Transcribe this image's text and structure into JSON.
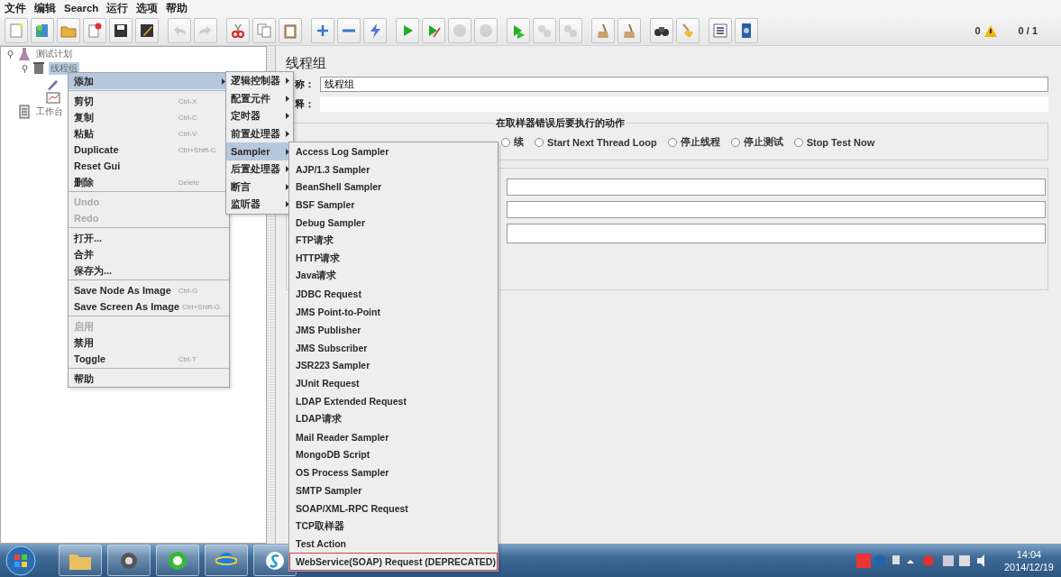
{
  "menubar": [
    "文件",
    "编辑",
    "Search",
    "运行",
    "选项",
    "帮助"
  ],
  "toolbar": {
    "groups": [
      [
        {
          "kind": "new",
          "disabled": false
        },
        {
          "kind": "templates",
          "disabled": false
        },
        {
          "kind": "open",
          "disabled": false
        },
        {
          "kind": "close",
          "disabled": false
        },
        {
          "kind": "save",
          "disabled": false
        },
        {
          "kind": "save_as",
          "disabled": false
        }
      ],
      [
        {
          "kind": "undo",
          "disabled": true
        },
        {
          "kind": "redo",
          "disabled": true
        }
      ],
      [
        {
          "kind": "cut",
          "disabled": false
        },
        {
          "kind": "copy",
          "disabled": false
        },
        {
          "kind": "paste",
          "disabled": false
        }
      ],
      [
        {
          "kind": "expand",
          "disabled": false
        },
        {
          "kind": "collapse",
          "disabled": false
        },
        {
          "kind": "toggle",
          "disabled": false
        }
      ],
      [
        {
          "kind": "start",
          "disabled": false
        },
        {
          "kind": "start_no_pause",
          "disabled": false
        },
        {
          "kind": "stop",
          "disabled": true
        },
        {
          "kind": "shutdown",
          "disabled": true
        }
      ],
      [
        {
          "kind": "remote_start",
          "disabled": false
        },
        {
          "kind": "remote_stop",
          "disabled": true
        },
        {
          "kind": "remote_shutdown",
          "disabled": true
        }
      ],
      [
        {
          "kind": "clear",
          "disabled": false
        },
        {
          "kind": "clear_all",
          "disabled": false
        }
      ],
      [
        {
          "kind": "search",
          "disabled": false
        },
        {
          "kind": "reset_search",
          "disabled": false
        }
      ],
      [
        {
          "kind": "functions",
          "disabled": false
        },
        {
          "kind": "help",
          "disabled": false
        }
      ]
    ],
    "error_count": "0",
    "threads": "0 / 1"
  },
  "tree": [
    {
      "kind": "plan",
      "label": "测试计划",
      "selected": false,
      "expanded": true,
      "children": [
        {
          "kind": "thread_group",
          "label": "线程组",
          "selected": true,
          "expanded": true,
          "children": [
            {
              "kind": "sampler",
              "selected": false,
              "expanded": false
            },
            {
              "kind": "listener",
              "selected": false,
              "expanded": false
            }
          ]
        }
      ]
    },
    {
      "kind": "workbench",
      "label": "工作台",
      "selected": false,
      "expanded": false
    }
  ],
  "editor": {
    "title": "线程组",
    "name_label": "称：",
    "name_value": "线程组",
    "comment_label": "释：",
    "error_action": {
      "title": "在取样器错误后要执行的动作",
      "options": [
        {
          "label": "续",
          "selected": false
        },
        {
          "label": "Start Next Thread Loop",
          "selected": false
        },
        {
          "label": "停止线程",
          "selected": false
        },
        {
          "label": "停止测试",
          "selected": false
        },
        {
          "label": "Stop Test Now",
          "selected": false
        }
      ]
    }
  },
  "context_menu": {
    "groups": [
      [
        {
          "label": "添加",
          "selected": true,
          "disabled": false,
          "submenu": true
        }
      ],
      [
        {
          "label": "剪切",
          "shortcut": "Ctrl-X",
          "selected": false,
          "disabled": false,
          "submenu": false
        },
        {
          "label": "复制",
          "shortcut": "Ctrl-C",
          "selected": false,
          "disabled": false,
          "submenu": false
        },
        {
          "label": "粘贴",
          "shortcut": "Ctrl-V",
          "selected": false,
          "disabled": false,
          "submenu": false
        },
        {
          "label": "Duplicate",
          "shortcut": "Ctrl+Shift-C",
          "selected": false,
          "disabled": false,
          "submenu": false
        },
        {
          "label": "Reset Gui",
          "selected": false,
          "disabled": false,
          "submenu": false
        },
        {
          "label": "删除",
          "shortcut": "Delete",
          "selected": false,
          "disabled": false,
          "submenu": false
        }
      ],
      [
        {
          "label": "Undo",
          "selected": false,
          "disabled": true,
          "submenu": false
        },
        {
          "label": "Redo",
          "selected": false,
          "disabled": true,
          "submenu": false
        }
      ],
      [
        {
          "label": "打开...",
          "selected": false,
          "disabled": false,
          "submenu": false
        },
        {
          "label": "合并",
          "selected": false,
          "disabled": false,
          "submenu": false
        },
        {
          "label": "保存为...",
          "selected": false,
          "disabled": false,
          "submenu": false
        }
      ],
      [
        {
          "label": "Save Node As Image",
          "shortcut": "Ctrl-G",
          "selected": false,
          "disabled": false,
          "submenu": false
        },
        {
          "label": "Save Screen As Image",
          "shortcut": "Ctrl+Shift-G",
          "selected": false,
          "disabled": false,
          "submenu": false
        }
      ],
      [
        {
          "label": "启用",
          "selected": false,
          "disabled": true,
          "submenu": false
        },
        {
          "label": "禁用",
          "selected": false,
          "disabled": false,
          "submenu": false
        },
        {
          "label": "Toggle",
          "shortcut": "Ctrl-T",
          "selected": false,
          "disabled": false,
          "submenu": false
        }
      ],
      [
        {
          "label": "帮助",
          "selected": false,
          "disabled": false,
          "submenu": false
        }
      ]
    ]
  },
  "add_menu": [
    {
      "label": "逻辑控制器",
      "selected": false
    },
    {
      "label": "配置元件",
      "selected": false
    },
    {
      "label": "定时器",
      "selected": false
    },
    {
      "label": "前置处理器",
      "selected": false
    },
    {
      "label": "Sampler",
      "selected": true
    },
    {
      "label": "后置处理器",
      "selected": false
    },
    {
      "label": "断言",
      "selected": false
    },
    {
      "label": "监听器",
      "selected": false
    }
  ],
  "sampler_menu": [
    {
      "label": "Access Log Sampler",
      "outlined": false
    },
    {
      "label": "AJP/1.3 Sampler",
      "outlined": false
    },
    {
      "label": "BeanShell Sampler",
      "outlined": false
    },
    {
      "label": "BSF Sampler",
      "outlined": false
    },
    {
      "label": "Debug Sampler",
      "outlined": false
    },
    {
      "label": "FTP请求",
      "outlined": false
    },
    {
      "label": "HTTP请求",
      "outlined": false
    },
    {
      "label": "Java请求",
      "outlined": false
    },
    {
      "label": "JDBC Request",
      "outlined": false
    },
    {
      "label": "JMS Point-to-Point",
      "outlined": false
    },
    {
      "label": "JMS Publisher",
      "outlined": false
    },
    {
      "label": "JMS Subscriber",
      "outlined": false
    },
    {
      "label": "JSR223 Sampler",
      "outlined": false
    },
    {
      "label": "JUnit Request",
      "outlined": false
    },
    {
      "label": "LDAP Extended Request",
      "outlined": false
    },
    {
      "label": "LDAP请求",
      "outlined": false
    },
    {
      "label": "Mail Reader Sampler",
      "outlined": false
    },
    {
      "label": "MongoDB Script",
      "outlined": false
    },
    {
      "label": "OS Process Sampler",
      "outlined": false
    },
    {
      "label": "SMTP Sampler",
      "outlined": false
    },
    {
      "label": "SOAP/XML-RPC Request",
      "outlined": false
    },
    {
      "label": "TCP取样器",
      "outlined": false
    },
    {
      "label": "Test Action",
      "outlined": false
    },
    {
      "label": "WebService(SOAP) Request (DEPRECATED)",
      "outlined": true
    }
  ],
  "taskbar": {
    "time": "14:04",
    "date": "2014/12/19"
  }
}
